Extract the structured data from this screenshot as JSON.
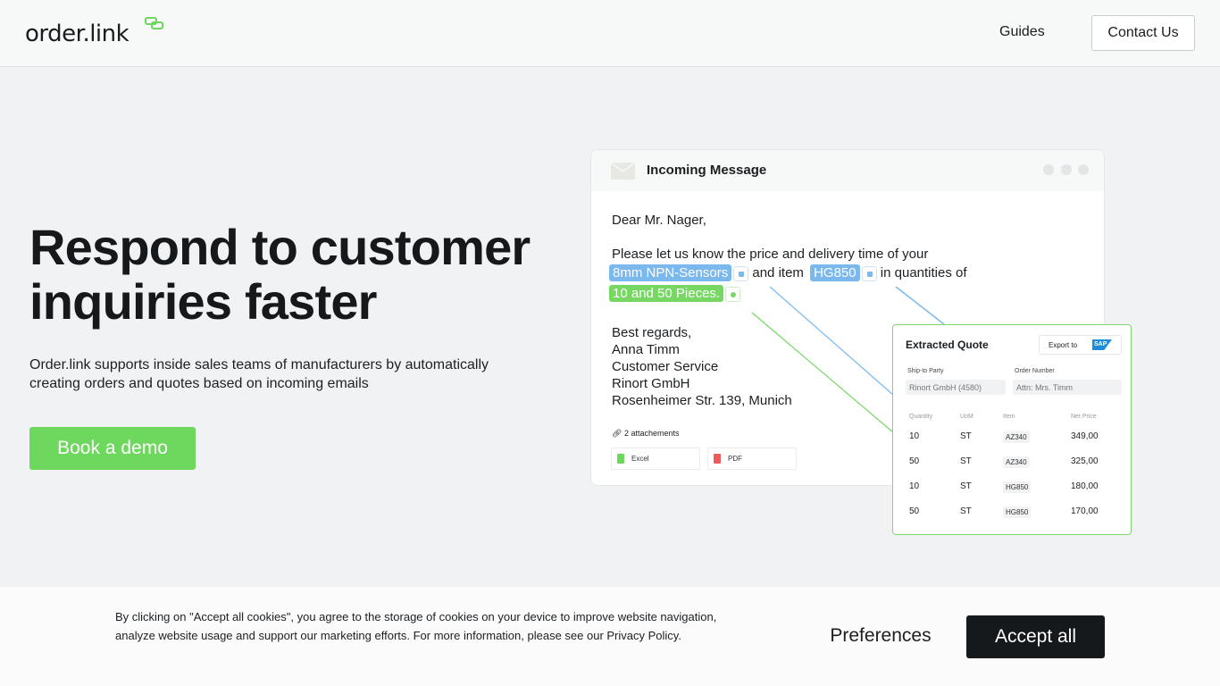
{
  "header": {
    "logo_text": "order.link",
    "nav_guides": "Guides",
    "contact_label": "Contact Us"
  },
  "hero": {
    "title": "Respond to customer inquiries faster",
    "subtitle": "Order.link supports inside sales teams of manufacturers by automatically creating orders and quotes based on incoming emails",
    "cta_label": "Book a demo"
  },
  "colors": {
    "accent_green": "#6ed85e",
    "accent_blue": "#7ab8ee",
    "dark": "#16191b"
  },
  "message_card": {
    "title": "Incoming Message",
    "icon": "envelope-icon",
    "greeting": "Dear Mr. Nager,",
    "line1": "Please let us know the price and delivery time of your",
    "chip_product": "8mm NPN-Sensors",
    "text_and_item": "and item",
    "chip_item": "HG850",
    "text_quantities": "in quantities of",
    "chip_quantity": "10 and 50 Pieces.",
    "closing": "Best regards,",
    "sig_name": "Anna Timm",
    "sig_role": "Customer Service",
    "sig_company": "Rinort GmbH",
    "sig_address": "Rosenheimer Str. 139, Munich",
    "attachments_label": "2 attachements",
    "attachments": [
      "Excel",
      "PDF"
    ]
  },
  "quote": {
    "title": "Extracted Quote",
    "export_label": "Export to",
    "export_brand": "SAP",
    "ship_label": "Ship-to Party",
    "ship_value": "Rinort GmbH (4580)",
    "order_label": "Order Number",
    "order_placeholder": "Attn: Mrs. Timm",
    "columns": [
      "Quantity",
      "UoM",
      "Item",
      "Net Price"
    ],
    "rows": [
      [
        "10",
        "ST",
        "AZ340",
        "349,00"
      ],
      [
        "50",
        "ST",
        "AZ340",
        "325,00"
      ],
      [
        "10",
        "ST",
        "HG850",
        "180,00"
      ],
      [
        "50",
        "ST",
        "HG850",
        "170,00"
      ]
    ]
  },
  "cookie": {
    "text": "By clicking on \"Accept all cookies\", you agree to the storage of cookies on your device to improve website navigation, analyze website usage and support our marketing efforts. For more information, please see our Privacy Policy.",
    "preferences_label": "Preferences",
    "accept_label": "Accept all"
  }
}
